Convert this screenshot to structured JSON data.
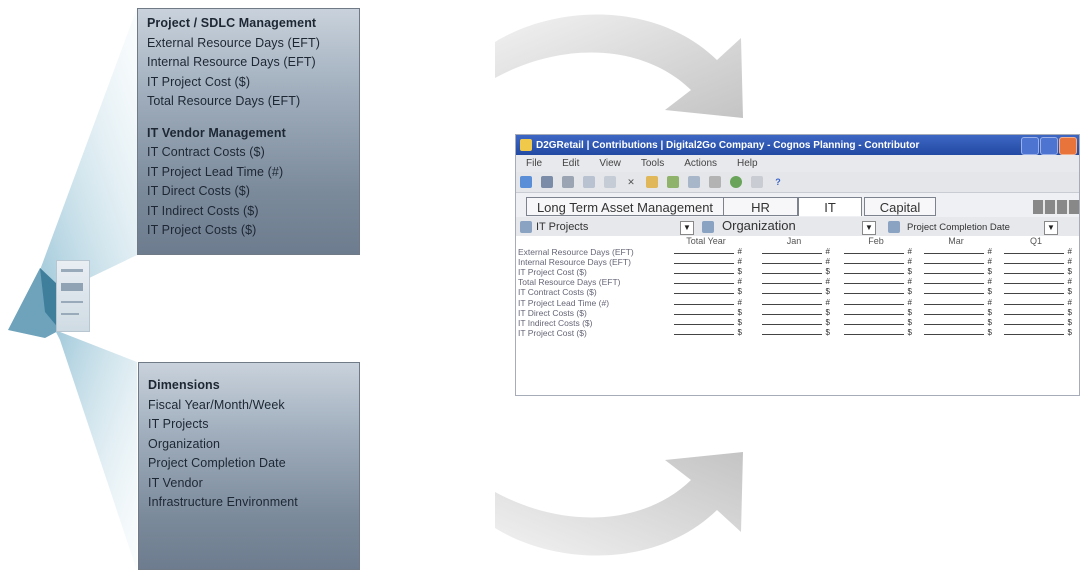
{
  "top_box": {
    "heading": "Project / SDLC Management",
    "items": [
      "External Resource Days (EFT)",
      "Internal Resource Days (EFT)",
      "IT Project Cost ($)",
      "Total Resource Days (EFT)"
    ],
    "heading2": "IT Vendor Management",
    "items2": [
      "IT Contract Costs ($)",
      "IT Project Lead Time (#)",
      "IT Direct Costs ($)",
      "IT Indirect Costs ($)",
      "IT Project Costs ($)"
    ]
  },
  "bottom_box": {
    "heading": "Dimensions",
    "items": [
      "Fiscal Year/Month/Week",
      "IT Projects",
      "Organization",
      "Project Completion Date",
      "IT Vendor",
      "Infrastructure Environment"
    ]
  },
  "app": {
    "title": "D2GRetail | Contributions | Digital2Go Company - Cognos Planning - Contributor",
    "menu": [
      "File",
      "Edit",
      "View",
      "Tools",
      "Actions",
      "Help"
    ],
    "tabs": [
      "Long Term Asset Management",
      "HR",
      "IT",
      "Capital"
    ],
    "active_tab": "IT",
    "filters": [
      "IT Projects",
      "Organization",
      "Project Completion Date"
    ],
    "columns": [
      "Total Year",
      "Jan",
      "Feb",
      "Mar",
      "Q1"
    ],
    "rows": [
      {
        "label": "External Resource Days (EFT)",
        "sym": "#"
      },
      {
        "label": "Internal Resource Days (EFT)",
        "sym": "#"
      },
      {
        "label": "IT Project Cost ($)",
        "sym": "$"
      },
      {
        "label": "Total Resource Days (EFT)",
        "sym": "#"
      },
      {
        "label": "IT Contract Costs ($)",
        "sym": "$"
      },
      {
        "label": "IT Project Lead Time (#)",
        "sym": "#"
      },
      {
        "label": "IT Direct Costs ($)",
        "sym": "$"
      },
      {
        "label": "IT Indirect Costs ($)",
        "sym": "$"
      },
      {
        "label": "IT Project Cost ($)",
        "sym": "$"
      }
    ],
    "colors": {
      "titlebar": "#2f57b5",
      "accent": "#f0c84a"
    }
  }
}
